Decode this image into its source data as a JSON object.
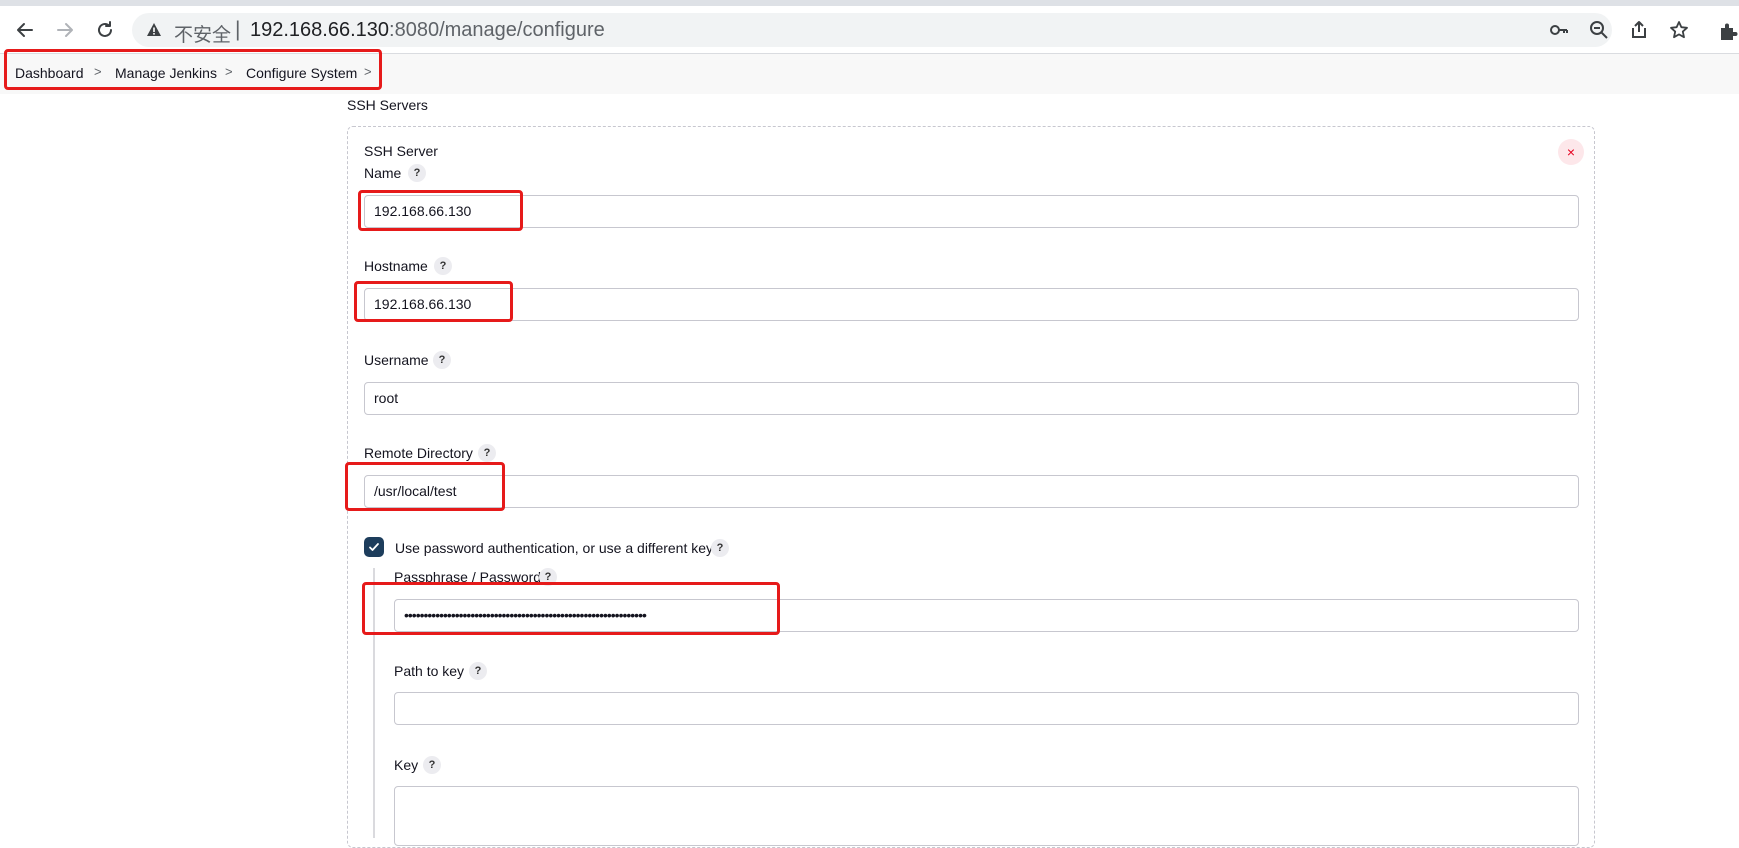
{
  "browser": {
    "security_label": "不安全",
    "separator": "|",
    "url_host": "192.168.66.130",
    "url_rest": ":8080/manage/configure",
    "icons": [
      "back-icon",
      "forward-icon",
      "reload-icon",
      "warning-icon",
      "key-icon",
      "zoom-out-icon",
      "share-icon",
      "bookmark-star-icon",
      "extensions-icon"
    ]
  },
  "breadcrumb": {
    "items": [
      "Dashboard",
      "Manage Jenkins",
      "Configure System"
    ],
    "separator": ">"
  },
  "section": {
    "title": "SSH Servers",
    "server_title": "SSH Server",
    "delete_symbol": "×"
  },
  "help_symbol": "?",
  "fields": {
    "name": {
      "label": "Name",
      "value": "192.168.66.130"
    },
    "hostname": {
      "label": "Hostname",
      "value": "192.168.66.130"
    },
    "username": {
      "label": "Username",
      "value": "root"
    },
    "remote_directory": {
      "label": "Remote Directory",
      "value": "/usr/local/test"
    },
    "use_password": {
      "label": "Use password authentication, or use a different key",
      "checked": true
    },
    "passphrase": {
      "label": "Passphrase / Password",
      "value": "••••••••••••••••••••••••••••••••••••••••••••••••••••••••••••••"
    },
    "path_to_key": {
      "label": "Path to key",
      "value": ""
    },
    "key": {
      "label": "Key",
      "value": ""
    }
  },
  "colors": {
    "highlight": "#e61a1a",
    "checkbox": "#1d3d5c",
    "delete": "#e6001f"
  }
}
